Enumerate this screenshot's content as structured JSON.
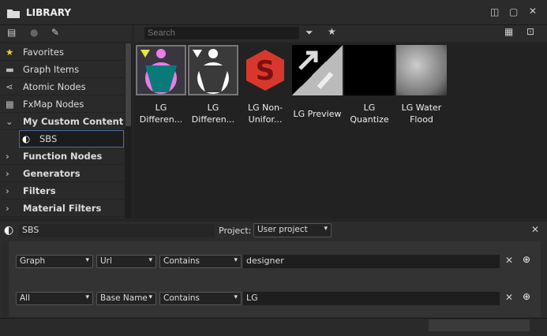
{
  "header": {
    "title": "LIBRARY"
  },
  "search": {
    "placeholder": "Search"
  },
  "tree": [
    {
      "label": "Favorites",
      "icon": "star-icon",
      "bold": false
    },
    {
      "label": "Graph Items",
      "icon": "speech-bubble-icon",
      "bold": false
    },
    {
      "label": "Atomic Nodes",
      "icon": "nodes-icon",
      "bold": false
    },
    {
      "label": "FxMap Nodes",
      "icon": "grid-icon",
      "bold": false
    },
    {
      "label": "My Custom Content",
      "icon": "chevron-down-icon",
      "bold": true
    },
    {
      "label": "SBS",
      "icon": "sbs-icon",
      "bold": false
    },
    {
      "label": "Function Nodes",
      "icon": "chevron-right-icon",
      "bold": true
    },
    {
      "label": "Generators",
      "icon": "chevron-right-icon",
      "bold": true
    },
    {
      "label": "Filters",
      "icon": "chevron-right-icon",
      "bold": true
    },
    {
      "label": "Material Filters",
      "icon": "chevron-right-icon",
      "bold": true
    }
  ],
  "items": [
    {
      "l1": "LG",
      "l2": "Differen..."
    },
    {
      "l1": "LG",
      "l2": "Differen..."
    },
    {
      "l1": "LG Non-",
      "l2": "Unifor..."
    },
    {
      "l1": "LG Preview",
      "l2": ""
    },
    {
      "l1": "LG",
      "l2": "Quantize"
    },
    {
      "l1": "LG Water",
      "l2": "Flood"
    }
  ],
  "filter": {
    "name": "SBS",
    "project_label": "Project:",
    "project": "User project",
    "rows": [
      {
        "a": "Graph",
        "b": "Url",
        "c": "Contains",
        "value": "designer"
      },
      {
        "a": "All",
        "b": "Base Name",
        "c": "Contains",
        "value": "LG"
      }
    ]
  },
  "colors": {
    "accent": "#4a6fa5"
  }
}
